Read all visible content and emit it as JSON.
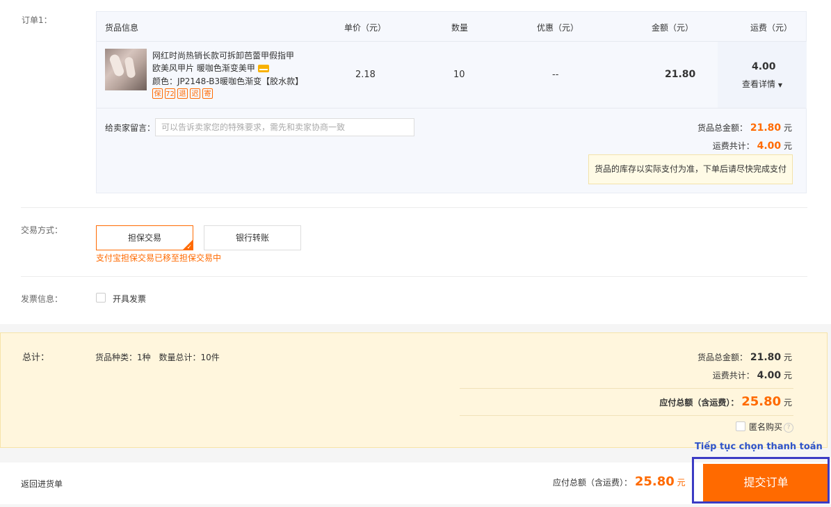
{
  "order": {
    "label": "订单1：",
    "columns": {
      "goods": "货品信息",
      "unit_price": "单价（元）",
      "qty": "数量",
      "discount": "优惠（元）",
      "amount": "金额（元）",
      "shipping": "运费（元）"
    },
    "item": {
      "title_line1": "网红时尚热销长款可拆卸芭蕾甲假指甲",
      "title_line2": "欧美风甲片 暖咖色渐变美甲",
      "attr": "颜色：JP2148-B3暖咖色渐变【胶水款】",
      "badges": [
        "保",
        "72",
        "退",
        "迟",
        "寄"
      ],
      "unit_price": "2.18",
      "qty": "10",
      "discount": "--",
      "amount": "21.80",
      "shipping": "4.00",
      "shipping_detail": "查看详情"
    },
    "message_label": "给卖家留言：",
    "message_placeholder": "可以告诉卖家您的特殊要求，需先和卖家协商一致",
    "goods_total_label": "货品总金额：",
    "goods_total": "21.80",
    "shipping_total_label": "运费共计：",
    "shipping_total": "4.00",
    "unit": "元",
    "notice": "货品的库存以实际支付为准，下单后请尽快完成支付"
  },
  "payment": {
    "label": "交易方式：",
    "options": [
      "担保交易",
      "银行转账"
    ],
    "note": "支付宝担保交易已移至担保交易中"
  },
  "invoice": {
    "label": "发票信息：",
    "checkbox_label": "开具发票"
  },
  "summary": {
    "label": "总计：",
    "types": "货品种类：1种",
    "qty_total": "数量总计：10件",
    "goods_total_label": "货品总金额：",
    "goods_total": "21.80",
    "shipping_label": "运费共计：",
    "shipping_total": "4.00",
    "payable_label": "应付总额（含运费）：",
    "payable": "25.80",
    "unit": "元",
    "anonymous_label": "匿名购买"
  },
  "footer": {
    "back_link": "返回进货单",
    "payable_label": "应付总额（含运费）：",
    "payable": "25.80",
    "unit": "元",
    "submit": "提交订单"
  },
  "annotation": {
    "label": "Tiếp tục chọn thanh toán"
  },
  "colors": {
    "accent": "#ff6a00",
    "highlight": "#3b3bc4"
  }
}
